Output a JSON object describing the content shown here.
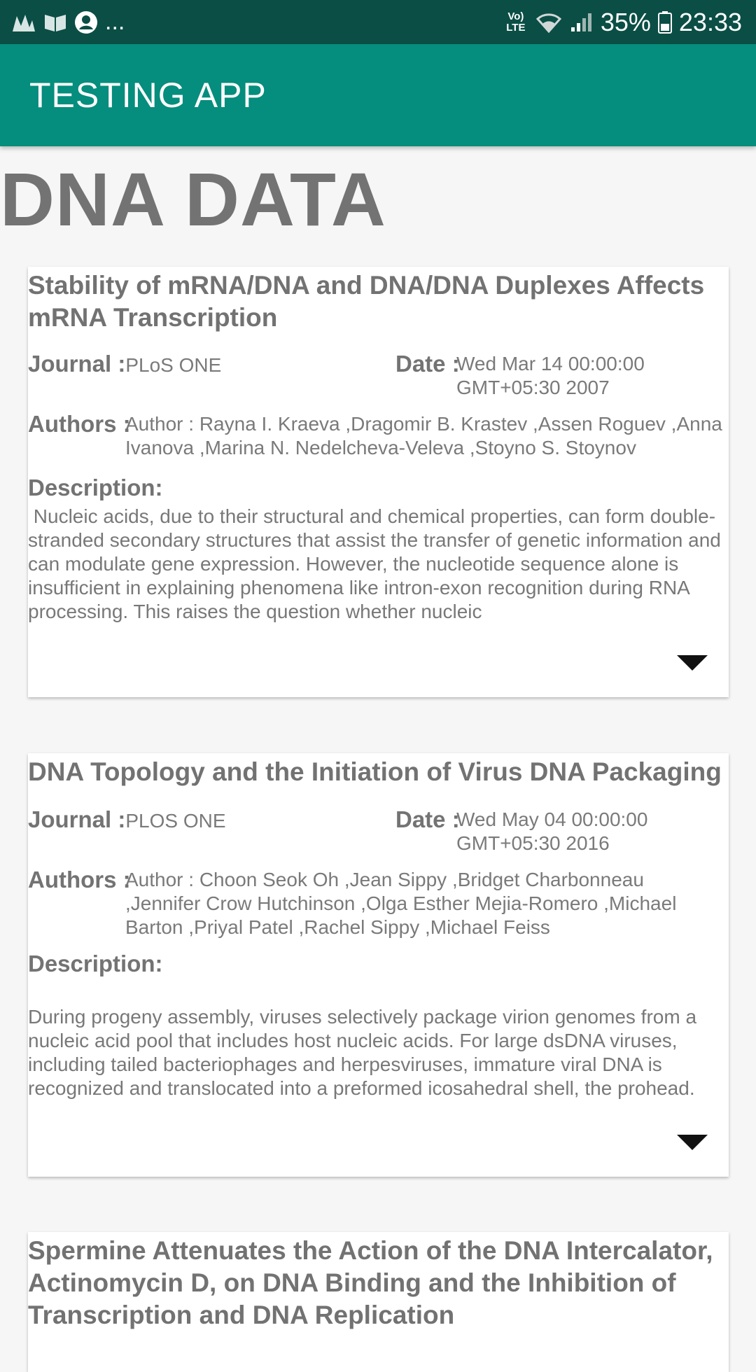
{
  "status_bar": {
    "left_icons": [
      "activity-icon",
      "book-icon",
      "account-icon"
    ],
    "more": "...",
    "network": "Vo) LTE",
    "battery": "35%",
    "time": "23:33"
  },
  "app_bar": {
    "title": "TESTING APP"
  },
  "page": {
    "title": "DNA DATA"
  },
  "labels": {
    "journal": "Journal :",
    "date": "Date :",
    "authors": "Authors :",
    "description": "Description:"
  },
  "cards": [
    {
      "title": "Stability of mRNA/DNA and DNA/DNA Duplexes Affects mRNA Transcription",
      "journal": "PLoS ONE",
      "date": "Wed Mar 14 00:00:00 GMT+05:30 2007",
      "authors": "Author :  Rayna I. Kraeva ,Dragomir B. Krastev ,Assen Roguev ,Anna Ivanova ,Marina N. Nedelcheva-Veleva ,Stoyno S. Stoynov",
      "description": " Nucleic acids, due to their structural and chemical properties, can form double-stranded secondary structures that assist the transfer of genetic information and can modulate gene expression. However, the nucleotide sequence alone is insufficient in explaining phenomena like intron-exon recognition during RNA processing. This raises the question whether nucleic"
    },
    {
      "title": "DNA Topology and the Initiation of Virus DNA Packaging",
      "journal": "PLOS ONE",
      "date": "Wed May 04 00:00:00 GMT+05:30 2016",
      "authors": "Author :  Choon Seok Oh ,Jean Sippy ,Bridget Charbonneau ,Jennifer Crow Hutchinson ,Olga Esther Mejia-Romero ,Michael Barton ,Priyal Patel ,Rachel Sippy ,Michael Feiss",
      "description": "During progeny assembly, viruses selectively package virion genomes from a nucleic acid pool that includes host nucleic acids. For large dsDNA viruses, including tailed bacteriophages and herpesviruses, immature viral DNA is recognized and translocated into a preformed icosahedral shell, the prohead."
    },
    {
      "title": "Spermine Attenuates the Action of the DNA Intercalator, Actinomycin D, on DNA Binding and the Inhibition of Transcription and DNA Replication"
    }
  ]
}
